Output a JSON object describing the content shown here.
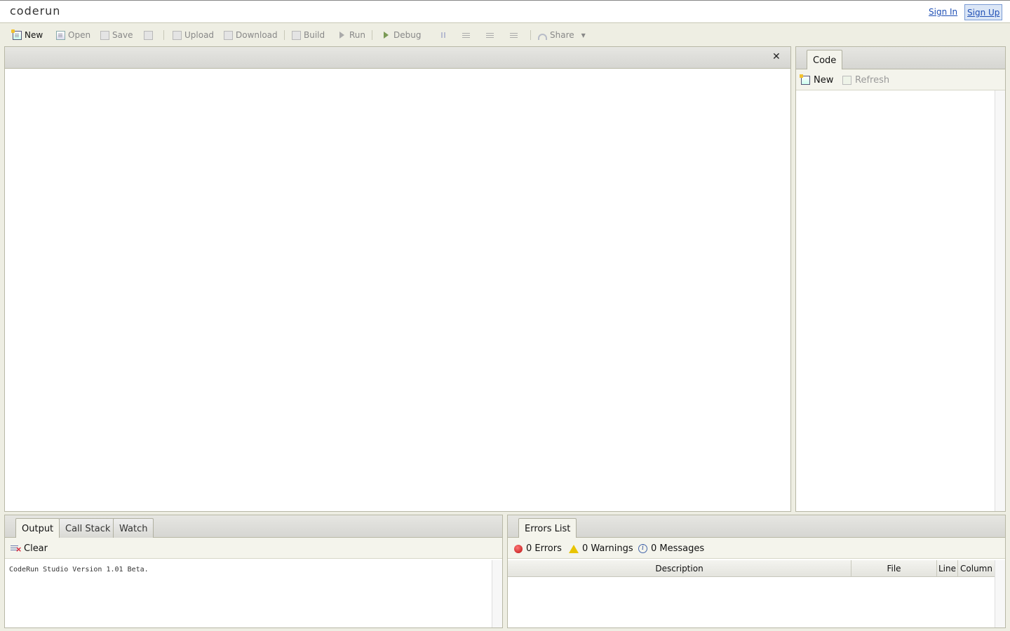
{
  "header": {
    "logo": "coderun",
    "sign_in": "Sign In",
    "sign_up": "Sign Up"
  },
  "toolbar": {
    "new": "New",
    "open": "Open",
    "save": "Save",
    "upload": "Upload",
    "download": "Download",
    "build": "Build",
    "run": "Run",
    "debug": "Debug",
    "share": "Share"
  },
  "side_panel": {
    "tab": "Code",
    "new": "New",
    "refresh": "Refresh"
  },
  "output_panel": {
    "tabs": [
      "Output",
      "Call Stack",
      "Watch"
    ],
    "clear": "Clear",
    "text": "CodeRun Studio Version 1.01 Beta."
  },
  "errors_panel": {
    "tab": "Errors List",
    "errors": "0 Errors",
    "warnings": "0 Warnings",
    "messages": "0 Messages",
    "columns": [
      "Description",
      "File",
      "Line",
      "Column"
    ]
  },
  "colors": {
    "link": "#1f4fb5",
    "chrome": "#eeeee3",
    "border": "#b8b8a6"
  }
}
